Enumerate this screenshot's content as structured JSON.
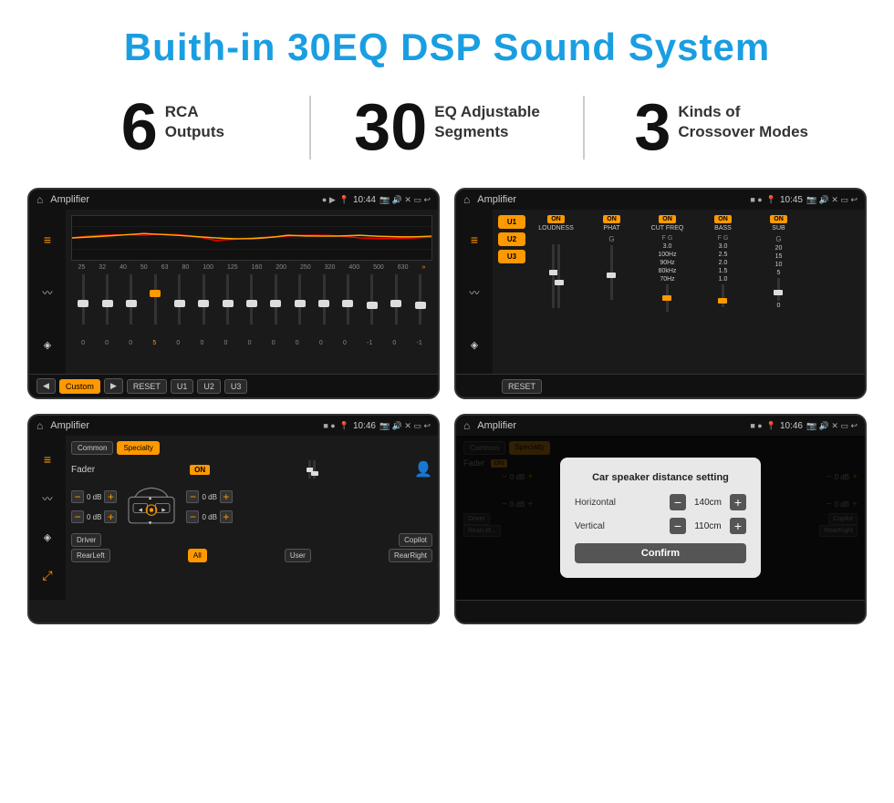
{
  "header": {
    "title": "Buith-in 30EQ DSP Sound System"
  },
  "stats": [
    {
      "number": "6",
      "label": "RCA\nOutputs"
    },
    {
      "number": "30",
      "label": "EQ Adjustable\nSegments"
    },
    {
      "number": "3",
      "label": "Kinds of\nCrossover Modes"
    }
  ],
  "screens": [
    {
      "id": "eq-screen",
      "statusbar": {
        "app": "Amplifier",
        "time": "10:44",
        "indicators": "● ▶"
      },
      "type": "eq"
    },
    {
      "id": "crossover-screen",
      "statusbar": {
        "app": "Amplifier",
        "time": "10:45",
        "indicators": "■ ●"
      },
      "type": "crossover"
    },
    {
      "id": "fader-screen",
      "statusbar": {
        "app": "Amplifier",
        "time": "10:46",
        "indicators": "■ ●"
      },
      "type": "fader"
    },
    {
      "id": "distance-screen",
      "statusbar": {
        "app": "Amplifier",
        "time": "10:46",
        "indicators": "■ ●"
      },
      "type": "distance",
      "dialog": {
        "title": "Car speaker distance setting",
        "horizontal_label": "Horizontal",
        "horizontal_value": "140cm",
        "vertical_label": "Vertical",
        "vertical_value": "110cm",
        "confirm_label": "Confirm"
      }
    }
  ],
  "eq": {
    "frequencies": [
      "25",
      "32",
      "40",
      "50",
      "63",
      "80",
      "100",
      "125",
      "160",
      "200",
      "250",
      "320",
      "400",
      "500",
      "630"
    ],
    "values": [
      "0",
      "0",
      "0",
      "5",
      "0",
      "0",
      "0",
      "0",
      "0",
      "0",
      "0",
      "0",
      "-1",
      "0",
      "-1"
    ],
    "buttons": [
      "◀",
      "Custom",
      "▶",
      "RESET",
      "U1",
      "U2",
      "U3"
    ]
  },
  "crossover": {
    "presets": [
      "U1",
      "U2",
      "U3"
    ],
    "channels": [
      {
        "toggle": "ON",
        "label": "LOUDNESS"
      },
      {
        "toggle": "ON",
        "label": "PHAT"
      },
      {
        "toggle": "ON",
        "label": "CUT FREQ"
      },
      {
        "toggle": "ON",
        "label": "BASS"
      },
      {
        "toggle": "ON",
        "label": "SUB"
      }
    ],
    "reset_label": "RESET"
  },
  "fader": {
    "tabs": [
      "Common",
      "Specialty"
    ],
    "fader_label": "Fader",
    "toggle": "ON",
    "speakers": {
      "front_left_db": "0 dB",
      "front_right_db": "0 dB",
      "rear_left_db": "0 dB",
      "rear_right_db": "0 dB"
    },
    "buttons": {
      "driver": "Driver",
      "copilot": "Copilot",
      "rear_left": "RearLeft",
      "all": "All",
      "user": "User",
      "rear_right": "RearRight"
    }
  },
  "distance_dialog": {
    "title": "Car speaker distance setting",
    "horizontal_label": "Horizontal",
    "horizontal_value": "140cm",
    "vertical_label": "Vertical",
    "vertical_value": "110cm",
    "confirm": "Confirm"
  }
}
